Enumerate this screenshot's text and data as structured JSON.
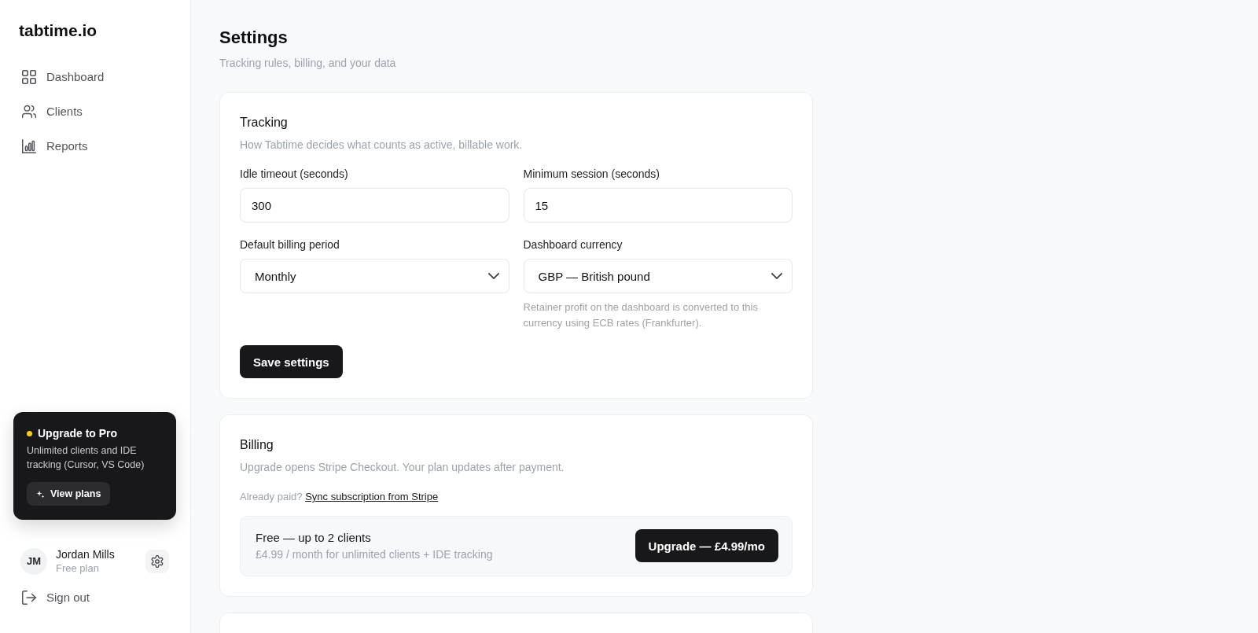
{
  "sidebar": {
    "logo": "tabtime.io",
    "nav": [
      {
        "label": "Dashboard",
        "selected": false
      },
      {
        "label": "Clients",
        "selected": false
      },
      {
        "label": "Reports",
        "selected": false
      }
    ],
    "upgrade_card": {
      "title": "Upgrade to Pro",
      "text": "Unlimited clients and IDE tracking (Cursor, VS Code)",
      "button": "View plans"
    },
    "user": {
      "initials": "JM",
      "name": "Jordan Mills",
      "plan": "Free plan"
    },
    "sign_out": "Sign out"
  },
  "page": {
    "title": "Settings",
    "subtitle": "Tracking rules, billing, and your data"
  },
  "tracking": {
    "title": "Tracking",
    "description": "How Tabtime decides what counts as active, billable work.",
    "fields": [
      {
        "kind": "input",
        "label": "Idle timeout (seconds)",
        "value": "300"
      },
      {
        "kind": "input",
        "label": "Minimum session (seconds)",
        "value": "15"
      },
      {
        "kind": "select",
        "label": "Default billing period",
        "value": "Monthly"
      },
      {
        "kind": "select",
        "label": "Dashboard currency",
        "value": "GBP — British pound",
        "help": "Retainer profit on the dashboard is converted to this currency using ECB rates (Frankfurter)."
      }
    ],
    "button": "Save settings"
  },
  "billing": {
    "title": "Billing",
    "description": "Upgrade opens Stripe Checkout. Your plan updates after payment.",
    "sync_prefix": "Already paid?",
    "sync_link": "Sync subscription from Stripe",
    "plan": {
      "name": "Free — up to 2 clients",
      "detail": "£4.99 / month for unlimited clients + IDE tracking",
      "button": "Upgrade — £4.99/mo"
    }
  }
}
